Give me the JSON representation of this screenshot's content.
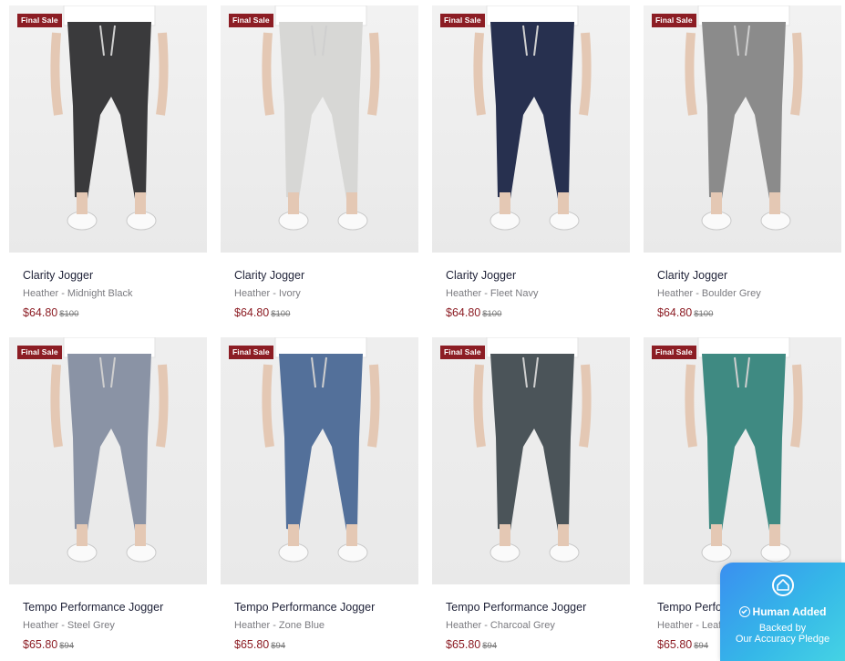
{
  "products": [
    {
      "badge": "Final Sale",
      "title": "Clarity Jogger",
      "color": "Heather - Midnight Black",
      "price": "$64.80",
      "compare": "$100",
      "top_color": "#ffffff",
      "pant_color": "#3a3a3c",
      "bg": "#f2f2f2"
    },
    {
      "badge": "Final Sale",
      "title": "Clarity Jogger",
      "color": "Heather - Ivory",
      "price": "$64.80",
      "compare": "$100",
      "top_color": "#ffffff",
      "pant_color": "#d7d7d5",
      "bg": "#f2f2f2"
    },
    {
      "badge": "Final Sale",
      "title": "Clarity Jogger",
      "color": "Heather - Fleet Navy",
      "price": "$64.80",
      "compare": "$100",
      "top_color": "#ffffff",
      "pant_color": "#27304f",
      "bg": "#f2f2f2"
    },
    {
      "badge": "Final Sale",
      "title": "Clarity Jogger",
      "color": "Heather - Boulder Grey",
      "price": "$64.80",
      "compare": "$100",
      "top_color": "#ffffff",
      "pant_color": "#8b8b8b",
      "bg": "#f2f2f2"
    },
    {
      "badge": "Final Sale",
      "title": "Tempo Performance Jogger",
      "color": "Heather - Steel Grey",
      "price": "$65.80",
      "compare": "$94",
      "top_color": "#ffffff",
      "pant_color": "#8a93a5",
      "bg": "#eeeeee"
    },
    {
      "badge": "Final Sale",
      "title": "Tempo Performance Jogger",
      "color": "Heather - Zone Blue",
      "price": "$65.80",
      "compare": "$94",
      "top_color": "#ffffff",
      "pant_color": "#53709a",
      "bg": "#eeeeee"
    },
    {
      "badge": "Final Sale",
      "title": "Tempo Performance Jogger",
      "color": "Heather - Charcoal Grey",
      "price": "$65.80",
      "compare": "$94",
      "top_color": "#ffffff",
      "pant_color": "#4b5459",
      "bg": "#eeeeee"
    },
    {
      "badge": "Final Sale",
      "title": "Tempo Performance Jogger",
      "color": "Heather - Leaf Green",
      "price": "$65.80",
      "compare": "$94",
      "top_color": "#ffffff",
      "pant_color": "#3f8a82",
      "bg": "#eeeeee"
    }
  ],
  "pledge": {
    "icon": "home-icon",
    "check_icon": "check-circle-icon",
    "title": "Human Added",
    "line1": "Backed by",
    "line2": "Our Accuracy Pledge"
  },
  "colors": {
    "sale": "#8c1d24",
    "title": "#1f2238"
  }
}
